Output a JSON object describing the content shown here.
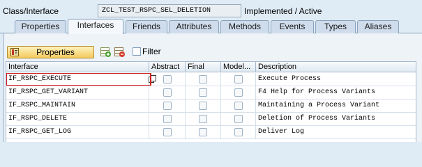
{
  "header": {
    "class_label": "Class/Interface",
    "class_value": "ZCL_TEST_RSPC_SEL_DELETION",
    "status": "Implemented / Active"
  },
  "tabs": [
    {
      "label": "Properties",
      "active": false
    },
    {
      "label": "Interfaces",
      "active": true
    },
    {
      "label": "Friends",
      "active": false
    },
    {
      "label": "Attributes",
      "active": false
    },
    {
      "label": "Methods",
      "active": false
    },
    {
      "label": "Events",
      "active": false
    },
    {
      "label": "Types",
      "active": false
    },
    {
      "label": "Aliases",
      "active": false
    }
  ],
  "toolbar": {
    "properties_label": "Properties",
    "filter_label": "Filter",
    "filter_checked": false
  },
  "table": {
    "columns": [
      "Interface",
      "Abstract",
      "Final",
      "Model...",
      "Description"
    ],
    "rows": [
      {
        "interface": "IF_RSPC_EXECUTE",
        "abstract": false,
        "final": false,
        "modeled": false,
        "description": "Execute Process"
      },
      {
        "interface": "IF_RSPC_GET_VARIANT",
        "abstract": false,
        "final": false,
        "modeled": false,
        "description": "F4 Help for Process Variants"
      },
      {
        "interface": "IF_RSPC_MAINTAIN",
        "abstract": false,
        "final": false,
        "modeled": false,
        "description": "Maintaining a Process Variant"
      },
      {
        "interface": "IF_RSPC_DELETE",
        "abstract": false,
        "final": false,
        "modeled": false,
        "description": "Deletion of Process Variants"
      },
      {
        "interface": "IF_RSPC_GET_LOG",
        "abstract": false,
        "final": false,
        "modeled": false,
        "description": "Deliver Log"
      }
    ]
  },
  "colors": {
    "background": "#dfebf5",
    "active_tab": "#f4f8fc",
    "button_gold": "#f3c95d",
    "focus_border": "#d42020"
  },
  "icons": {
    "properties_button": "properties-icon",
    "toolbar": [
      "add-row-icon",
      "delete-row-icon"
    ],
    "cell_action": "readonly-cell-icon"
  }
}
